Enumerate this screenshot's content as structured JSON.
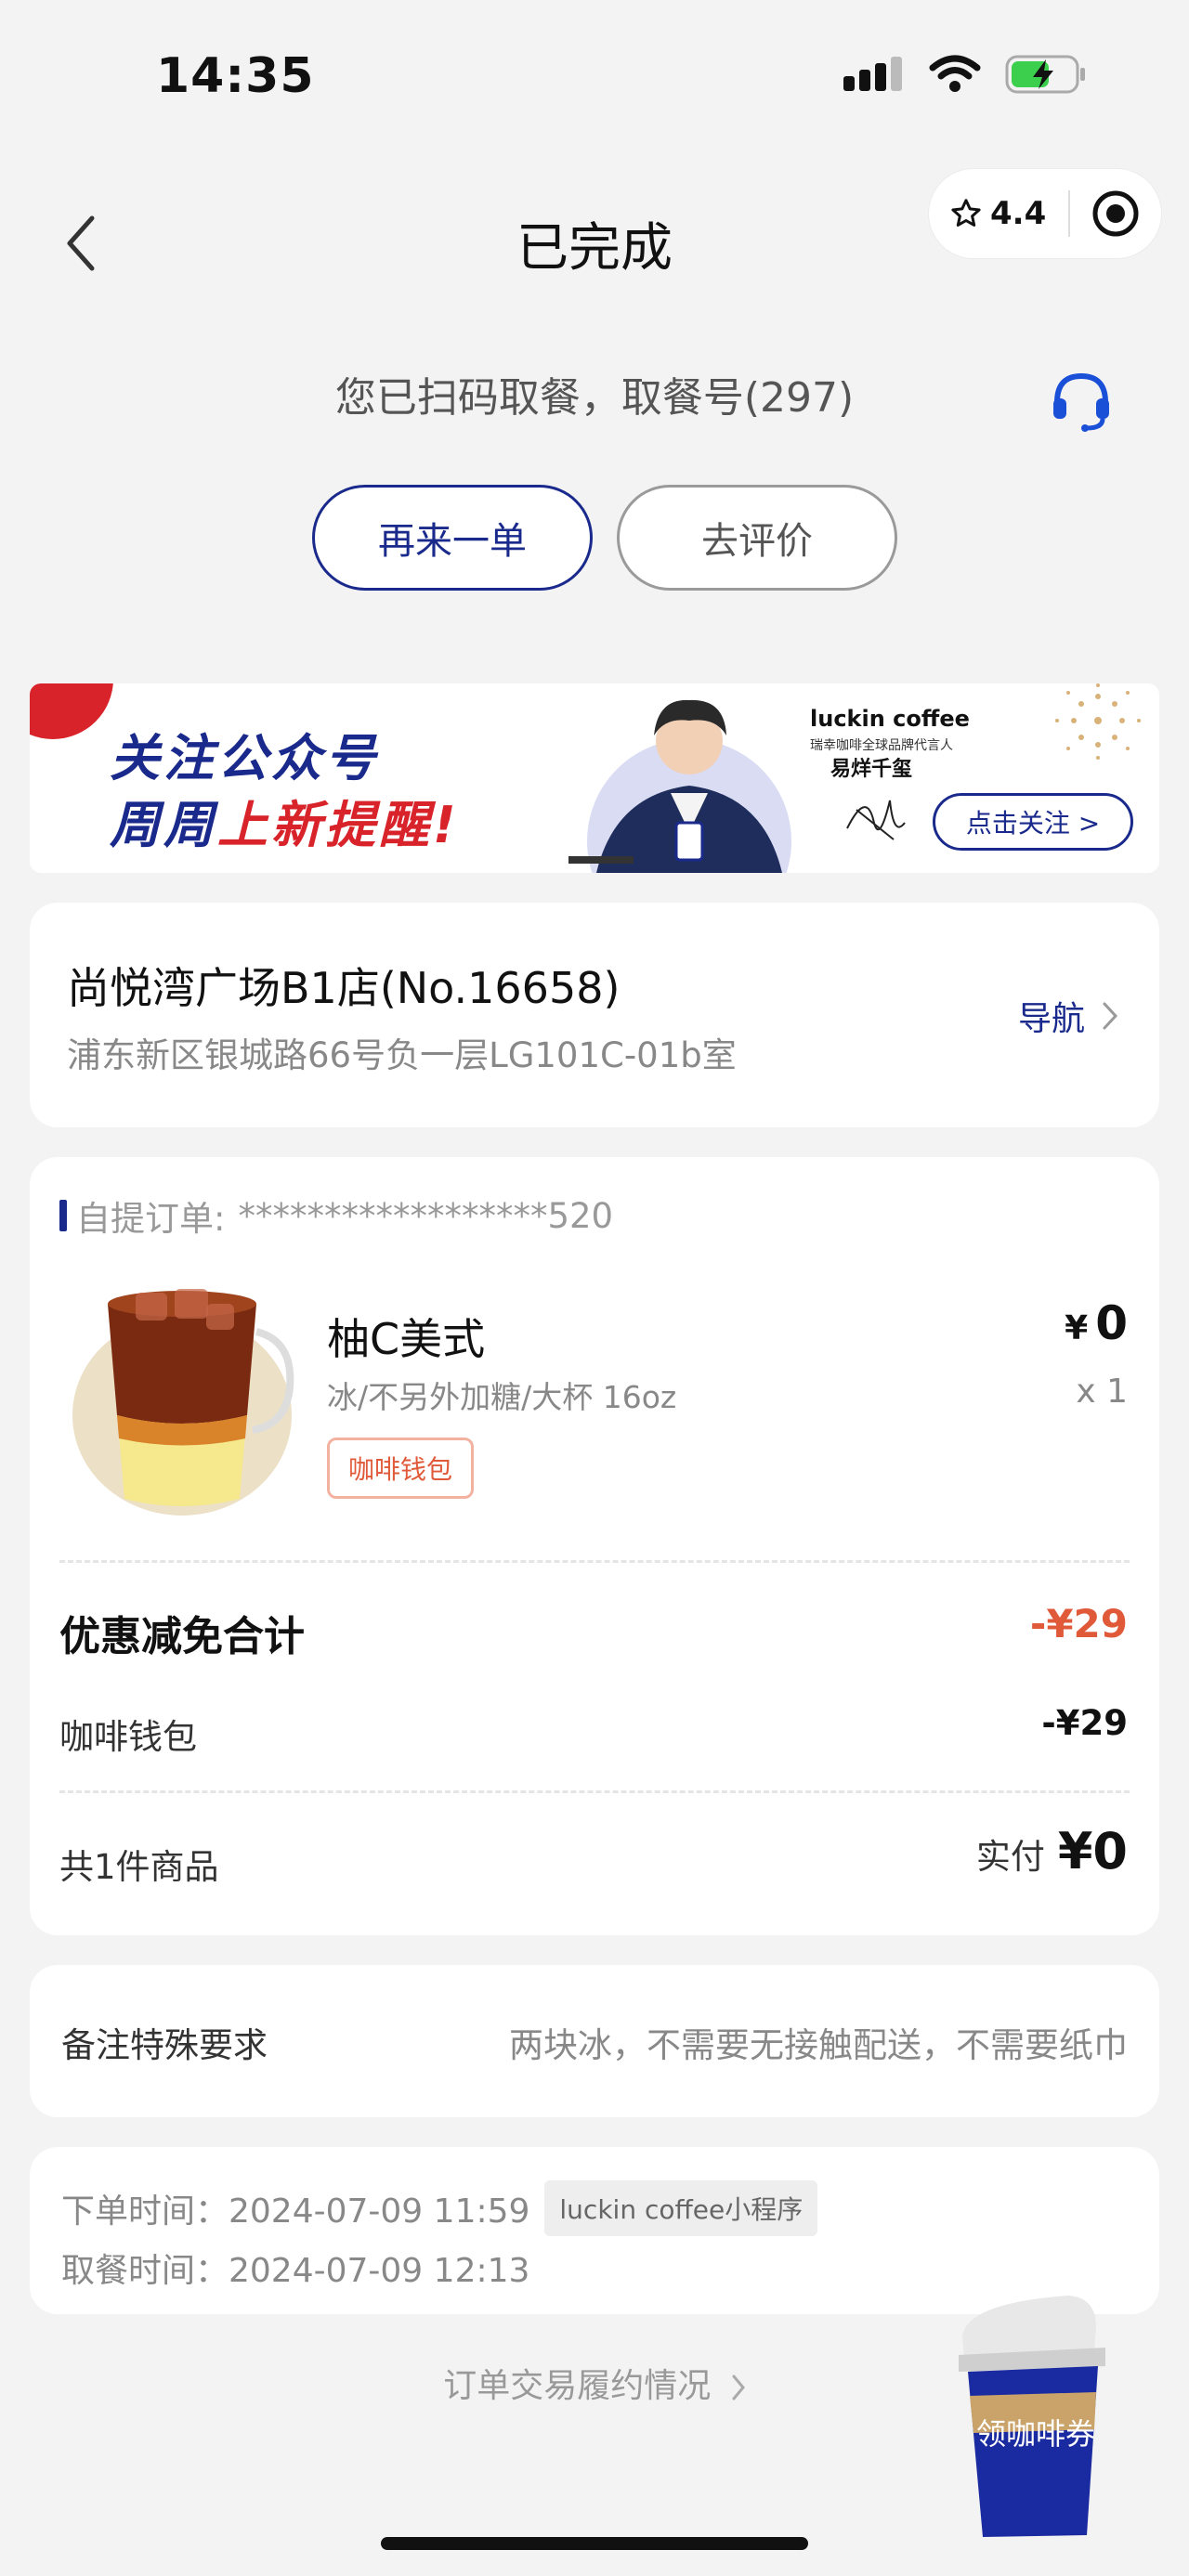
{
  "status_bar": {
    "time": "14:35"
  },
  "nav": {
    "title": "已完成",
    "rating": "4.4"
  },
  "order_status": {
    "message": "您已扫码取餐，取餐号(297)",
    "reorder_label": "再来一单",
    "review_label": "去评价"
  },
  "banner": {
    "line1": "关注公众号",
    "line2_prefix": "周周",
    "line2_highlight": "上新提醒!",
    "brand": "luckin coffee",
    "brand_sub": "瑞幸咖啡全球品牌代言人",
    "ambassador": "易烊千玺",
    "follow_label": "点击关注 >"
  },
  "store": {
    "name": "尚悦湾广场B1店(No.16658)",
    "address": "浦东新区银城路66号负一层LG101C-01b室",
    "nav_label": "导航"
  },
  "order": {
    "id_label": "自提订单:",
    "id_value": "******************520",
    "product": {
      "name": "柚C美式",
      "spec": "冰/不另外加糖/大杯 16oz",
      "tag": "咖啡钱包",
      "price_symbol": "¥",
      "price": "0",
      "qty": "x 1"
    },
    "discount_total_label": "优惠减免合计",
    "discount_total_value": "-¥29",
    "wallet_label": "咖啡钱包",
    "wallet_value": "-¥29",
    "items_count": "共1件商品",
    "paid_label": "实付",
    "paid_value": "¥0"
  },
  "note": {
    "label": "备注特殊要求",
    "value": "两块冰，不需要无接触配送，不需要纸巾"
  },
  "times": {
    "order_time": "下单时间：2024-07-09 11:59",
    "channel": "luckin coffee小程序",
    "pickup_time": "取餐时间：2024-07-09 12:13"
  },
  "fulfilment_link": "订单交易履约情况",
  "floating_coupon": "领咖啡券",
  "colors": {
    "brand_blue": "#1a2a8c",
    "accent_red": "#d8232a",
    "discount_orange": "#e05a3a"
  }
}
